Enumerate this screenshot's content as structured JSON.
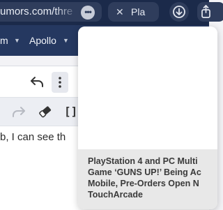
{
  "browser": {
    "url_text": "umors.com/thre",
    "tab_title": "Pla"
  },
  "site_nav": {
    "items": [
      "m",
      "Apollo"
    ]
  },
  "editor": {
    "content_text": "b, I can see th"
  },
  "link_preview": {
    "caption_lines": [
      "PlayStation 4 and PC Multi",
      "Game ‘GUNS UP!’ Being Ac",
      "Mobile, Pre-Orders Open N",
      "TouchArcade"
    ]
  },
  "icons": {
    "more_button": "ellipsis-icon",
    "close_tab": "close-icon",
    "download": "download-icon",
    "share": "share-icon",
    "undo": "undo-icon",
    "redo": "redo-icon",
    "more_vertical": "vertical-ellipsis-icon",
    "eraser": "eraser-icon",
    "brackets": "brackets-icon"
  },
  "colors": {
    "browser_bar": "#1b2a4a",
    "site_nav": "#253860",
    "caption_bg": "#e8e8e8"
  }
}
